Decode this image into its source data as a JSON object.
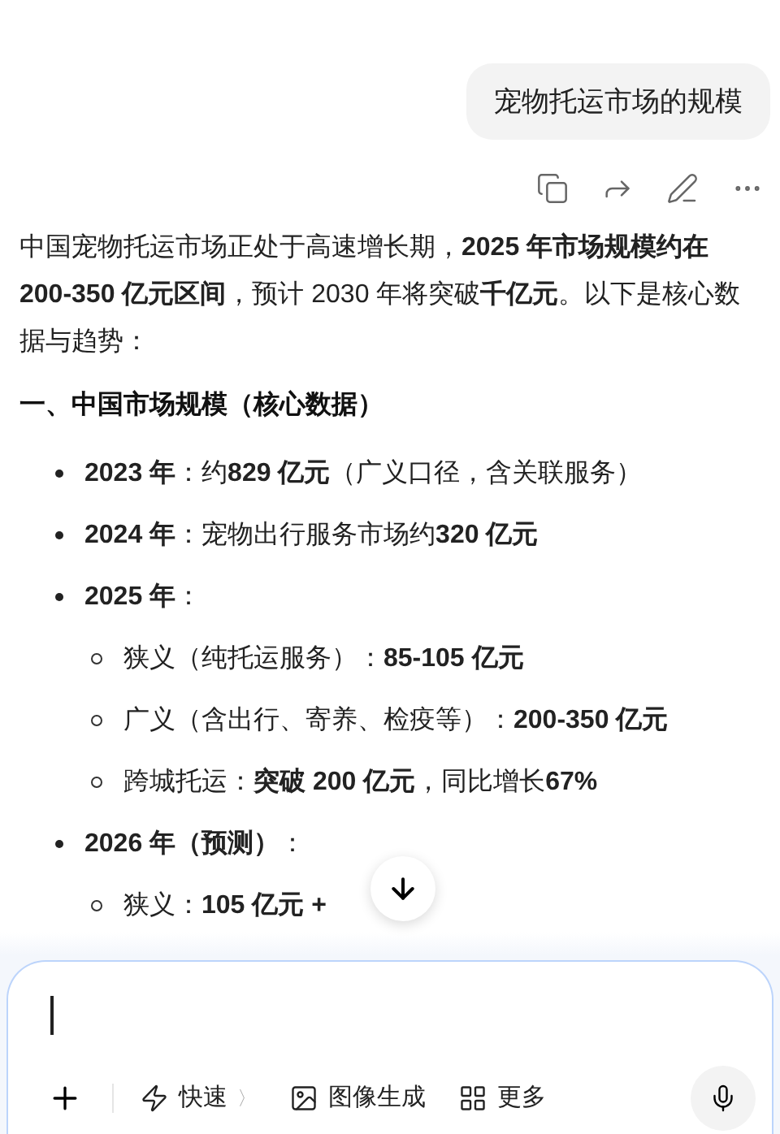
{
  "user_message": "宠物托运市场的规模",
  "intro": "中国宠物托运市场正处于高速增长期，**2025 年市场规模约在 200-350 亿元区间**，预计 2030 年将突破**千亿元**。以下是核心数据与趋势：",
  "heading": "一、中国市场规模（核心数据）",
  "items": [
    {
      "text": "**2023 年**：约**829 亿元**（广义口径，含关联服务）"
    },
    {
      "text": "**2024 年**：宠物出行服务市场约**320 亿元**"
    },
    {
      "text": "**2025 年**：",
      "children": [
        {
          "text": "狭义（纯托运服务）：**85-105 亿元**"
        },
        {
          "text": "广义（含出行、寄养、检疫等）：**200-350 亿元**"
        },
        {
          "text": "跨城托运：**突破 200 亿元**，同比增长**67%**"
        }
      ]
    },
    {
      "text": "**2026 年（预测）**：",
      "children": [
        {
          "text": "狭义：**105 亿元 +**"
        }
      ]
    }
  ],
  "composer": {
    "tools": [
      {
        "kind": "quick",
        "label": "快速",
        "chevron": "〉"
      },
      {
        "kind": "image",
        "label": "图像生成"
      },
      {
        "kind": "more",
        "label": "更多"
      }
    ]
  }
}
